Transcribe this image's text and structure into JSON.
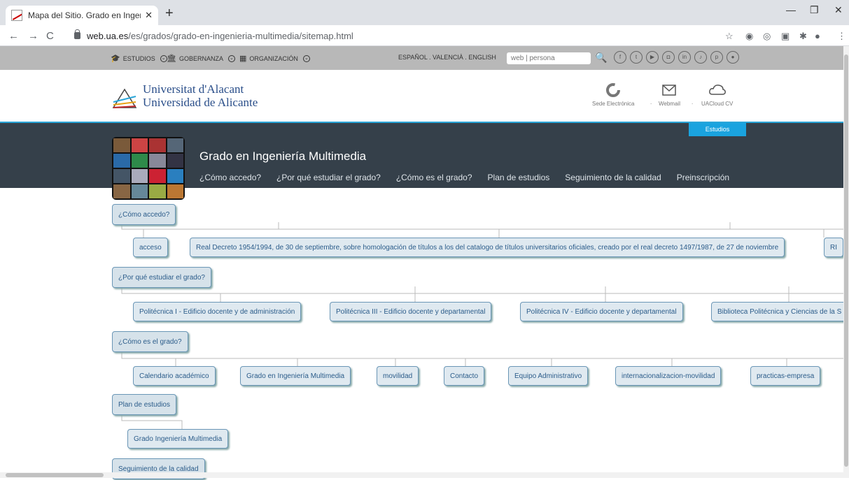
{
  "browser": {
    "tab_title": "Mapa del Sitio. Grado en Ingenie",
    "url_host": "web.ua.es",
    "url_path": "/es/grados/grado-en-ingenieria-multimedia/sitemap.html"
  },
  "sitebar": {
    "estudios": "ESTUDIOS",
    "gobernanza": "GOBERNANZA",
    "organizacion": "ORGANIZACIÓN",
    "langs": "ESPAÑOL  .  VALENCIÀ  .  ENGLISH",
    "search_placeholder": "web | persona"
  },
  "header": {
    "univ_line1": "Universitat d'Alacant",
    "univ_line2": "Universidad de Alicante",
    "sede": "Sede Electrónica",
    "webmail": "Webmail",
    "uacloud": "UACloud CV",
    "estudios_tab": "Estudios"
  },
  "banner": {
    "title": "Grado en Ingeniería Multimedia",
    "menu": [
      "¿Cómo accedo?",
      "¿Por qué estudiar el grado?",
      "¿Cómo es el grado?",
      "Plan de estudios",
      "Seguimiento de la calidad",
      "Preinscripción"
    ]
  },
  "sitemap": {
    "sections": [
      {
        "label": "¿Cómo accedo?",
        "children": [
          "acceso",
          "Real Decreto 1954/1994, de 30 de septiembre, sobre homologación de títulos a los del catalogo de títulos universitarios oficiales, creado por el real decreto 1497/1987, de 27 de noviembre",
          "RI"
        ]
      },
      {
        "label": "¿Por qué estudiar el grado?",
        "children": [
          "Politécnica I - Edificio docente y de administración",
          "Politécnica III - Edificio docente y departamental",
          "Politécnica IV - Edificio docente y departamental",
          "Biblioteca Politécnica y Ciencias de la S"
        ]
      },
      {
        "label": "¿Cómo es el grado?",
        "children": [
          "Calendario académico",
          "Grado en Ingeniería Multimedia",
          "movilidad",
          "Contacto",
          "Equipo Administrativo",
          "internacionalizacion-movilidad",
          "practicas-empresa"
        ]
      },
      {
        "label": "Plan de estudios",
        "children": [
          "Grado Ingeniería Multimedia"
        ]
      },
      {
        "label": "Seguimiento de la calidad",
        "children": []
      }
    ]
  }
}
